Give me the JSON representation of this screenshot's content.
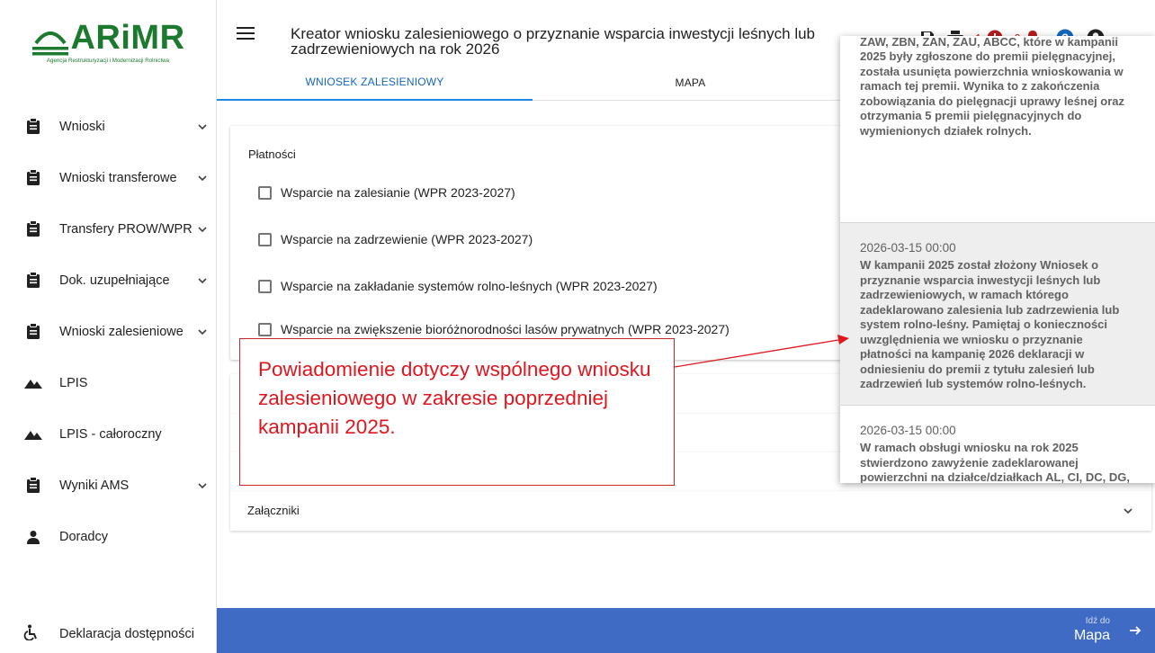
{
  "brand": {
    "name": "ARiMR",
    "subtitle": "Agencja Restrukturyzacji i Modernizacji Rolnictwa",
    "color": "#1b7a2e"
  },
  "sidebar": {
    "items": [
      {
        "label": "Wnioski",
        "icon": "clipboard-icon",
        "expandable": true
      },
      {
        "label": "Wnioski transferowe",
        "icon": "clipboard-icon",
        "expandable": true
      },
      {
        "label": "Transfery PROW/WPR",
        "icon": "clipboard-icon",
        "expandable": true
      },
      {
        "label": "Dok. uzupełniające",
        "icon": "clipboard-icon",
        "expandable": true
      },
      {
        "label": "Wnioski zalesieniowe",
        "icon": "clipboard-icon",
        "expandable": true
      },
      {
        "label": "LPIS",
        "icon": "terrain-icon",
        "expandable": false
      },
      {
        "label": "LPIS - całoroczny",
        "icon": "terrain-icon",
        "expandable": false
      },
      {
        "label": "Wyniki AMS",
        "icon": "clipboard-icon",
        "expandable": true
      },
      {
        "label": "Doradcy",
        "icon": "person-icon",
        "expandable": false
      }
    ],
    "footer": {
      "label": "Deklaracja dostępności",
      "icon": "accessibility-icon"
    }
  },
  "header": {
    "title": "Kreator wniosku zalesieniowego o przyznanie wsparcia inwestycji leśnych lub zadrzewieniowych na rok 2026",
    "error_count": "1",
    "notification_count": "6",
    "error_color": "#b71c1c",
    "help_color": "#1565c0"
  },
  "tabs": [
    {
      "label": "WNIOSEK ZALESIENIOWY",
      "active": true
    },
    {
      "label": "MAPA",
      "active": false
    }
  ],
  "payments": {
    "header": "Płatności",
    "options": [
      "Wsparcie na zalesianie (WPR 2023-2027)",
      "Wsparcie na zadrzewienie (WPR 2023-2027)",
      "Wsparcie na zakładanie systemów rolno-leśnych (WPR 2023-2027)",
      "Wsparcie na zwiększenie bioróżnorodności lasów prywatnych (WPR 2023-2027)"
    ]
  },
  "attachments": {
    "label": "Załączniki"
  },
  "bottom_bar": {
    "small": "Idź do",
    "big": "Mapa",
    "color": "#3f6bc4"
  },
  "notifications": [
    {
      "date": "",
      "text": "działek rolnych AL, CI, DC, DG, EL, ABMM, ZAM, ZAW, ZBN, ZAN, ZAU, ABCC, które w kampanii 2025 były zgłoszone do premii pielęgnacyjnej, została usunięta powierzchnia wnioskowania w ramach tej premii. Wynika to z zakończenia zobowiązania do pielęgnacji uprawy leśnej oraz otrzymania 5 premii pielęgnacyjnych do wymienionych działek rolnych."
    },
    {
      "date": "2026-03-15 00:00",
      "text": "W kampanii 2025 został złożony Wniosek o przyznanie wsparcia inwestycji leśnych lub zadrzewieniowych, w ramach którego zadeklarowano zalesienia lub zadrzewienia lub system rolno-leśny. Pamiętaj o konieczności uwzględnienia we wniosku o przyznanie płatności na kampanię 2026 deklaracji w odniesieniu do premii z tytułu zalesień lub zadrzewień lub systemów rolno-leśnych."
    },
    {
      "date": "2026-03-15 00:00",
      "text": "W ramach obsługi wniosku na rok 2025 stwierdzono zawyżenie zadeklarowanej powierzchni na działce/działkach AL, CI, DC, DG, EL. Granice stwierdzonych działek rolnych są dostępne w zakładce Mapa po włączeniu"
    }
  ],
  "callout": {
    "text": "Powiadomienie dotyczy wspólnego wniosku zalesieniowego w zakresie poprzedniej kampanii 2025.",
    "color": "#e0161e"
  }
}
